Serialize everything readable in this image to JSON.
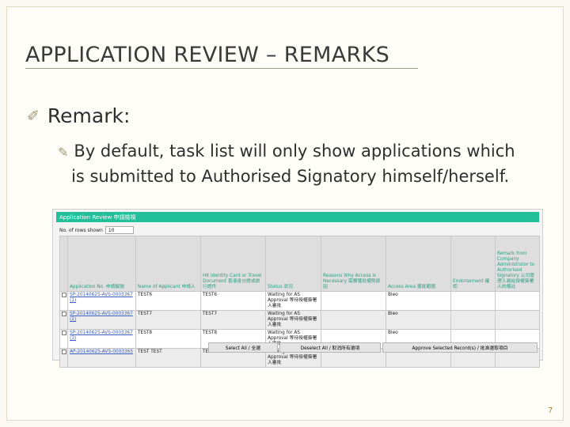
{
  "slide": {
    "title": "APPLICATION REVIEW – REMARKS",
    "bullet": "Remark:",
    "sub_bullet_line1": "By default, task list will only show applications which",
    "sub_bullet_line2": "is submitted to Authorised Signatory himself/herself.",
    "page_number": "7",
    "icons": {
      "bullet": "checkmark-arrow-icon",
      "sub_bullet": "pencil-icon"
    }
  },
  "app": {
    "header_title": "Application Review 申請檢視",
    "rows_shown_label": "No. of rows shown",
    "rows_shown_value": "10",
    "columns": [
      "",
      "Application No. 申請編號",
      "Name of Applicant 申請人",
      "HK Identity Card or Travel Document 香港身分證或旅行證件",
      "Status 狀況",
      "Reasons Why Access is Necessary 需要獲批權限原因",
      "Access Area 獲批範圍",
      "Endorsement 確認",
      "Remark from Company Administrator to Authorised Signatory 公司管理人員給授權簽署人的備註"
    ],
    "rows": [
      {
        "app_no": "SP-20140625-AVS-0003367 (1)",
        "name": "TEST6",
        "id": "TEST6",
        "status": "Waiting for AS Approval 等待授權簽署人審批",
        "reason": "",
        "area": "Bleo",
        "endorse": "",
        "remark": ""
      },
      {
        "app_no": "SP-20140625-AVS-0003367 (2)",
        "name": "TEST7",
        "id": "TEST7",
        "status": "Waiting for AS Approval 等待授權簽署人審批",
        "reason": "",
        "area": "Bleo",
        "endorse": "",
        "remark": ""
      },
      {
        "app_no": "SP-20140625-AVS-0003367 (3)",
        "name": "TEST8",
        "id": "TEST8",
        "status": "Waiting for AS Approval 等待授權簽署人審批",
        "reason": "",
        "area": "Bleo",
        "endorse": "",
        "remark": ""
      },
      {
        "app_no": "AP-20140625-AVS-0003365",
        "name": "TEST TEST",
        "id": "TEST2",
        "status": "Waiting for AS Approval 等待授權簽署人審批",
        "reason": "test",
        "area": "Bleo",
        "endorse": "",
        "remark": "test"
      }
    ],
    "buttons": {
      "select_all": "Select All / 全選",
      "deselect_all": "Deselect All / 取消所有選項",
      "approve": "Approve Selected Record(s) / 批准選取項目"
    }
  }
}
